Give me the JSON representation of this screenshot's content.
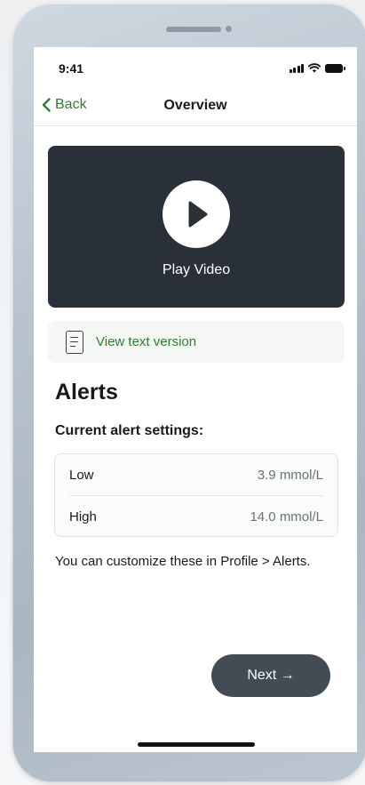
{
  "status_bar": {
    "time": "9:41"
  },
  "nav": {
    "back_label": "Back",
    "title": "Overview"
  },
  "video": {
    "label": "Play Video"
  },
  "text_version": {
    "label": "View text version"
  },
  "alerts": {
    "title": "Alerts",
    "settings_heading": "Current alert settings:",
    "rows": [
      {
        "name": "Low",
        "value": "3.9 mmol/L"
      },
      {
        "name": "High",
        "value": "14.0 mmol/L"
      }
    ],
    "info": "You can customize these in Profile > Alerts."
  },
  "footer": {
    "next_label": "Next →"
  },
  "colors": {
    "accent_green": "#2e7d32",
    "video_bg": "#2a3038",
    "next_bg": "#434b55"
  },
  "icons": {
    "back": "chevron-left-icon",
    "play": "play-icon",
    "document": "document-icon",
    "signal": "cellular-signal-icon",
    "wifi": "wifi-icon",
    "battery": "battery-icon"
  }
}
